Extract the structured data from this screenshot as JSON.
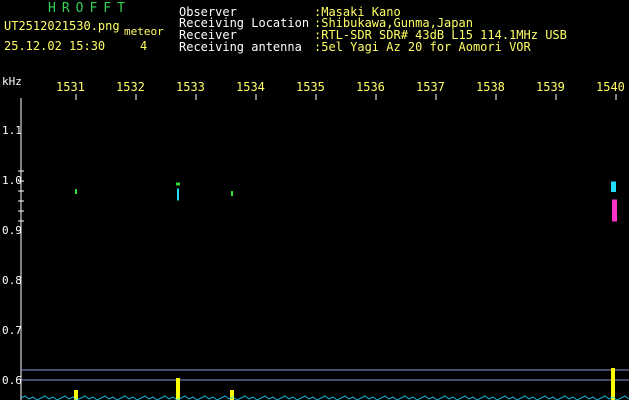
{
  "header": {
    "app_title": "HROFFT",
    "file_name": "UT2512021530.png",
    "meteor_label": "meteor",
    "date_time": "25.12.02 15:30",
    "meteor_count": "4"
  },
  "info": [
    {
      "label": "Observer",
      "value": ":Masaki Kano"
    },
    {
      "label": "Receiving Location",
      "value": ":Shibukawa,Gunma,Japan"
    },
    {
      "label": "Receiver",
      "value": ":RTL-SDR SDR# 43dB L15 114.1MHz USB"
    },
    {
      "label": "Receiving antenna",
      "value": ":5el Yagi Az 20 for Aomori VOR"
    }
  ],
  "axis": {
    "unit": "kHz",
    "y_ticks": [
      "1.1",
      "1.0",
      "0.9",
      "0.8",
      "0.7",
      "0.6"
    ],
    "time_labels": [
      "1531",
      "1532",
      "1533",
      "1534",
      "1535",
      "1536",
      "1537",
      "1538",
      "1539",
      "1540"
    ]
  },
  "colors": {
    "background": "#000000",
    "label_yellow": "#ffff66",
    "label_white": "#ffffff",
    "title_green": "#34d058",
    "echo_green": "#33dd33",
    "echo_cyan": "#22ddff",
    "echo_magenta": "#ff33cc",
    "spike_yellow": "#ffff00",
    "grid_blue": "#0a1a5a"
  },
  "echoes": [
    {
      "time_min": 1532.7,
      "freq_khz_low": 0.955,
      "freq_khz_high": 0.985,
      "intensity": "high"
    },
    {
      "time_min": 1531.0,
      "freq_khz_low": 0.91,
      "freq_khz_high": 0.92,
      "intensity": "low"
    },
    {
      "time_min": 1533.6,
      "freq_khz_low": 0.89,
      "freq_khz_high": 0.9,
      "intensity": "low"
    },
    {
      "time_min": 1539.95,
      "freq_khz_low": 0.89,
      "freq_khz_high": 0.995,
      "intensity": "very-high"
    }
  ]
}
